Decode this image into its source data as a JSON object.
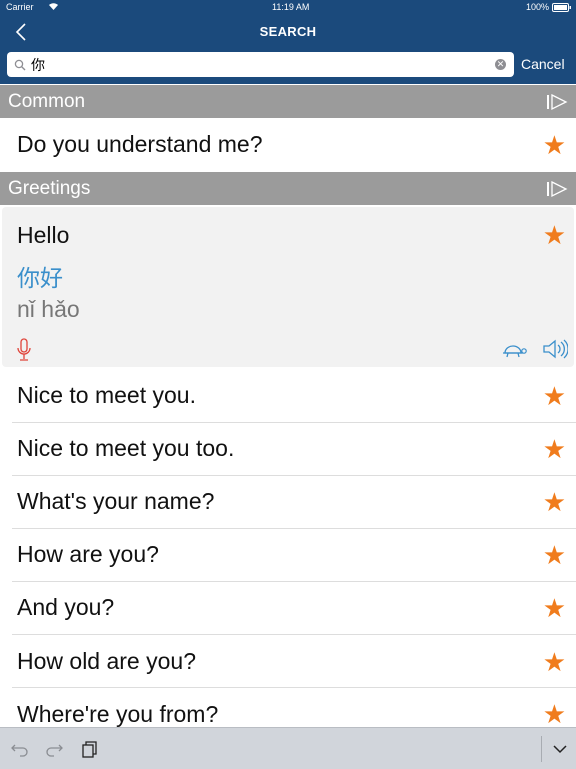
{
  "status": {
    "carrier": "Carrier",
    "time": "11:19 AM",
    "battery": "100%"
  },
  "nav": {
    "title": "SEARCH",
    "back_icon": "chevron-left-icon"
  },
  "search": {
    "value": "你",
    "placeholder": "",
    "cancel_label": "Cancel"
  },
  "sections": [
    {
      "label": "Common",
      "icon": "play-icon"
    },
    {
      "label": "Greetings",
      "icon": "play-icon"
    }
  ],
  "common_phrases": [
    {
      "text": "Do you understand me?",
      "starred": true
    }
  ],
  "expanded_phrase": {
    "english": "Hello",
    "chinese": "你好",
    "pinyin": "nǐ hǎo",
    "star": "★",
    "icons": [
      "microphone-icon",
      "turtle-icon",
      "speaker-icon"
    ]
  },
  "greeting_phrases": [
    {
      "text": "Nice to meet you.",
      "starred": true
    },
    {
      "text": "Nice to meet you too.",
      "starred": true
    },
    {
      "text": "What's your name?",
      "starred": true
    },
    {
      "text": "How are you?",
      "starred": true
    },
    {
      "text": "And you?",
      "starred": true
    },
    {
      "text": "How old are you?",
      "starred": true
    },
    {
      "text": "Where're you from?",
      "starred": true
    }
  ],
  "star_glyph": "★",
  "toolbar": {
    "icons": [
      "undo-icon",
      "redo-icon",
      "clipboard-icon",
      "keyboard-dismiss-icon"
    ]
  },
  "colors": {
    "nav_bg": "#1b4a7c",
    "section_bg": "#9b9b9b",
    "star": "#f07c1d",
    "chinese_text": "#3a8fcb",
    "mic": "#e0443a",
    "icon_blue": "#3a8fcb"
  }
}
